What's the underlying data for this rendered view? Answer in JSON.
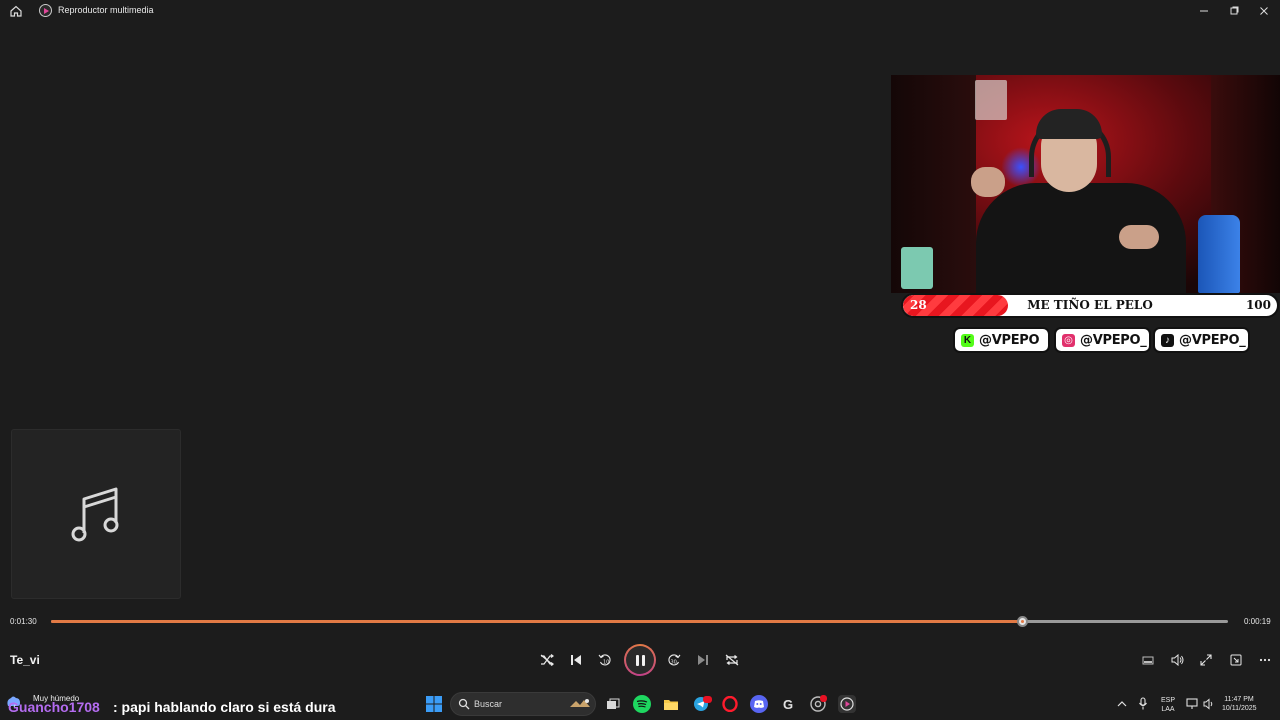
{
  "window": {
    "title": "Reproductor multimedia",
    "icons": {
      "home": "home-icon",
      "app": "media-player-icon"
    },
    "controls": [
      "minimize-icon",
      "maximize-icon",
      "close-icon"
    ]
  },
  "overlay": {
    "goal": {
      "min": "28",
      "label": "ME TIÑO EL PELO",
      "max": "100",
      "progress_fraction": 0.28
    },
    "socials": [
      {
        "handle": "@VPEPO",
        "icon": "kick-icon",
        "color": "#53fc18"
      },
      {
        "handle": "@VPEPO_",
        "icon": "instagram-icon",
        "color": "#e1306c"
      },
      {
        "handle": "@VPEPO_",
        "icon": "tiktok-icon",
        "color": "#111111"
      }
    ]
  },
  "player": {
    "elapsed": "0:01:30",
    "remaining": "0:00:19",
    "progress_fraction": 0.825,
    "track_title": "Te_vi",
    "album_art_icon": "music-note-icon",
    "accent": "#e27a45"
  },
  "controls": {
    "shuffle": "shuffle-icon",
    "previous": "previous-icon",
    "rewind": "rewind-10-icon",
    "play_pause": "pause-icon",
    "forward": "forward-30-icon",
    "next": "next-icon",
    "repeat": "repeat-off-icon",
    "right": [
      "miniplayer-icon",
      "volume-icon",
      "fullscreen-icon",
      "cast-icon",
      "more-icon"
    ]
  },
  "chat": {
    "weather": "Muy húmedo",
    "username": "Guancho1708",
    "message": ": papi hablando claro si está dura"
  },
  "taskbar": {
    "search_placeholder": "Buscar",
    "language": "ESP",
    "layout": "LAA",
    "time": "11:47 PM",
    "date": "10/11/2025"
  }
}
